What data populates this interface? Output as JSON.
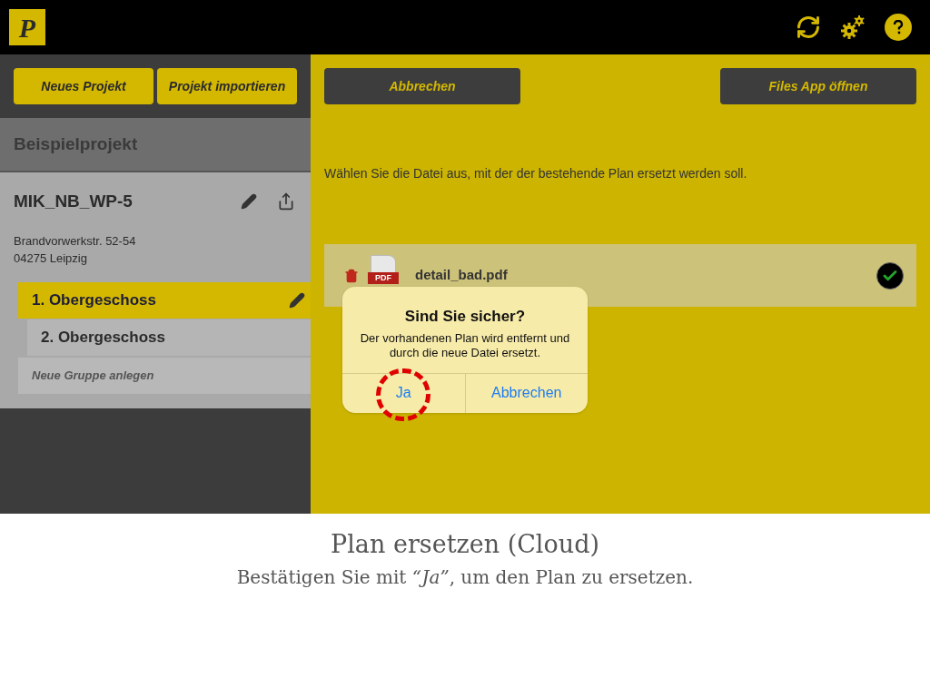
{
  "header": {
    "logo": "P"
  },
  "sidebar": {
    "buttons": [
      "Neues Projekt",
      "Projekt importieren"
    ],
    "section_title": "Beispielprojekt",
    "project": {
      "name": "MIK_NB_WP-5",
      "address": [
        "Brandvorwerkstr. 52-54",
        "04275 Leipzig"
      ]
    },
    "groups": [
      {
        "label": "1. Obergeschoss",
        "selected": true
      },
      {
        "label": "2. Obergeschoss",
        "selected": false
      }
    ],
    "new_group": "Neue Gruppe anlegen"
  },
  "main": {
    "cancel_button": "Abbrechen",
    "files_button": "Files App öffnen",
    "instruction": "Wählen Sie die Datei aus, mit der der bestehende Plan ersetzt werden soll.",
    "file": {
      "icon_label": "PDF",
      "name": "detail_bad.pdf",
      "checked": true
    }
  },
  "dialog": {
    "title": "Sind Sie sicher?",
    "message": "Der vorhandenen Plan wird entfernt und durch die neue Datei ersetzt.",
    "buttons": [
      {
        "label": "Ja",
        "highlighted": true
      },
      {
        "label": "Abbrechen",
        "highlighted": false
      }
    ]
  },
  "caption": {
    "title": "Plan ersetzen (Cloud)",
    "text": "Bestätigen Sie mit *“Ja”*, um den Plan zu ersetzen."
  }
}
